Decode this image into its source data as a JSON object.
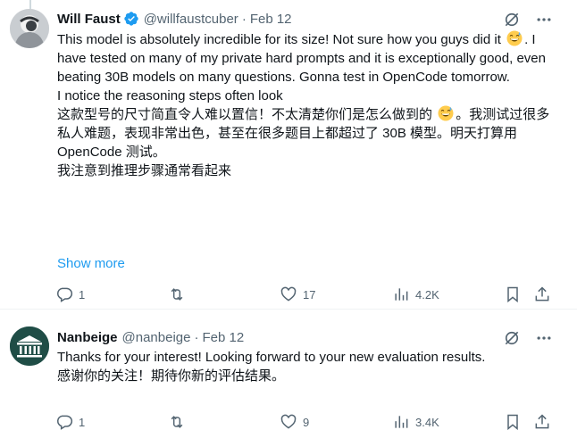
{
  "tweets": [
    {
      "author": {
        "name": "Will Faust",
        "handle": "@willfaustcuber",
        "verified": true,
        "avatar_icon": "user-photo-avatar"
      },
      "separator": "·",
      "date": "Feb 12",
      "text": {
        "line1_a": "This model is absolutely incredible for its size! Not sure how you guys did it",
        "line1_b": ". I have tested on many of my private hard prompts and it is exceptionally good, even beating 30B models on many questions. Gonna test in OpenCode tomorrow.",
        "line2": "I notice the reasoning steps often look",
        "zh_a": "这款型号的尺寸简直令人难以置信！不太清楚你们是怎么做到的",
        "zh_b": "。我测试过很多私人难题，表现非常出色，甚至在很多题目上都超过了 30B 模型。明天打算用 OpenCode 测试。",
        "zh_2": "我注意到推理步骤通常看起来"
      },
      "show_more": "Show more",
      "stats": {
        "replies": "1",
        "retweets": "",
        "likes": "17",
        "views": "4.2K"
      }
    },
    {
      "author": {
        "name": "Nanbeige",
        "handle": "@nanbeige",
        "verified": false,
        "avatar_icon": "nanbeige-logo-avatar"
      },
      "separator": "·",
      "date": "Feb 12",
      "text": {
        "line1": "Thanks for your interest! Looking forward to your new evaluation results.",
        "zh_1": "感谢你的关注！期待你新的评估结果。"
      },
      "stats": {
        "replies": "1",
        "retweets": "",
        "likes": "9",
        "views": "3.4K"
      }
    }
  ],
  "colors": {
    "text": "#0f1419",
    "secondary": "#536471",
    "link": "#1d9bf0",
    "verified": "#1d9bf0",
    "divider": "#eff3f4"
  }
}
